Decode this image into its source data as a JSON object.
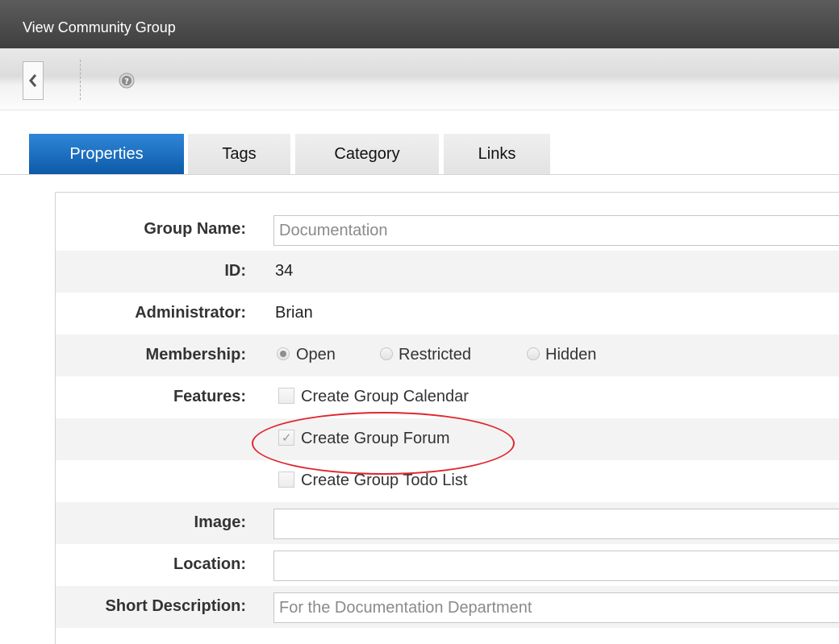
{
  "window": {
    "title": "View Community Group"
  },
  "toolbar": {
    "back_icon": "chevron-left-icon",
    "help_icon": "help-icon"
  },
  "tabs": [
    {
      "label": "Properties",
      "active": true
    },
    {
      "label": "Tags",
      "active": false
    },
    {
      "label": "Category",
      "active": false
    },
    {
      "label": "Links",
      "active": false
    }
  ],
  "form": {
    "group_name": {
      "label": "Group Name:",
      "value": "Documentation"
    },
    "id": {
      "label": "ID:",
      "value": "34"
    },
    "administrator": {
      "label": "Administrator:",
      "value": "Brian"
    },
    "membership": {
      "label": "Membership:",
      "options": [
        {
          "label": "Open",
          "selected": true
        },
        {
          "label": "Restricted",
          "selected": false
        },
        {
          "label": "Hidden",
          "selected": false
        }
      ]
    },
    "features": {
      "label": "Features:",
      "options": [
        {
          "label": "Create Group Calendar",
          "checked": false
        },
        {
          "label": "Create Group Forum",
          "checked": true
        },
        {
          "label": "Create Group Todo List",
          "checked": false
        }
      ]
    },
    "image": {
      "label": "Image:",
      "value": ""
    },
    "location": {
      "label": "Location:",
      "value": ""
    },
    "short_description": {
      "label": "Short Description:",
      "value": "For the Documentation Department"
    }
  },
  "colors": {
    "active_tab": "#1b6fc4",
    "highlight_ring": "#e0262f",
    "titlebar": "#4a4a4a"
  }
}
